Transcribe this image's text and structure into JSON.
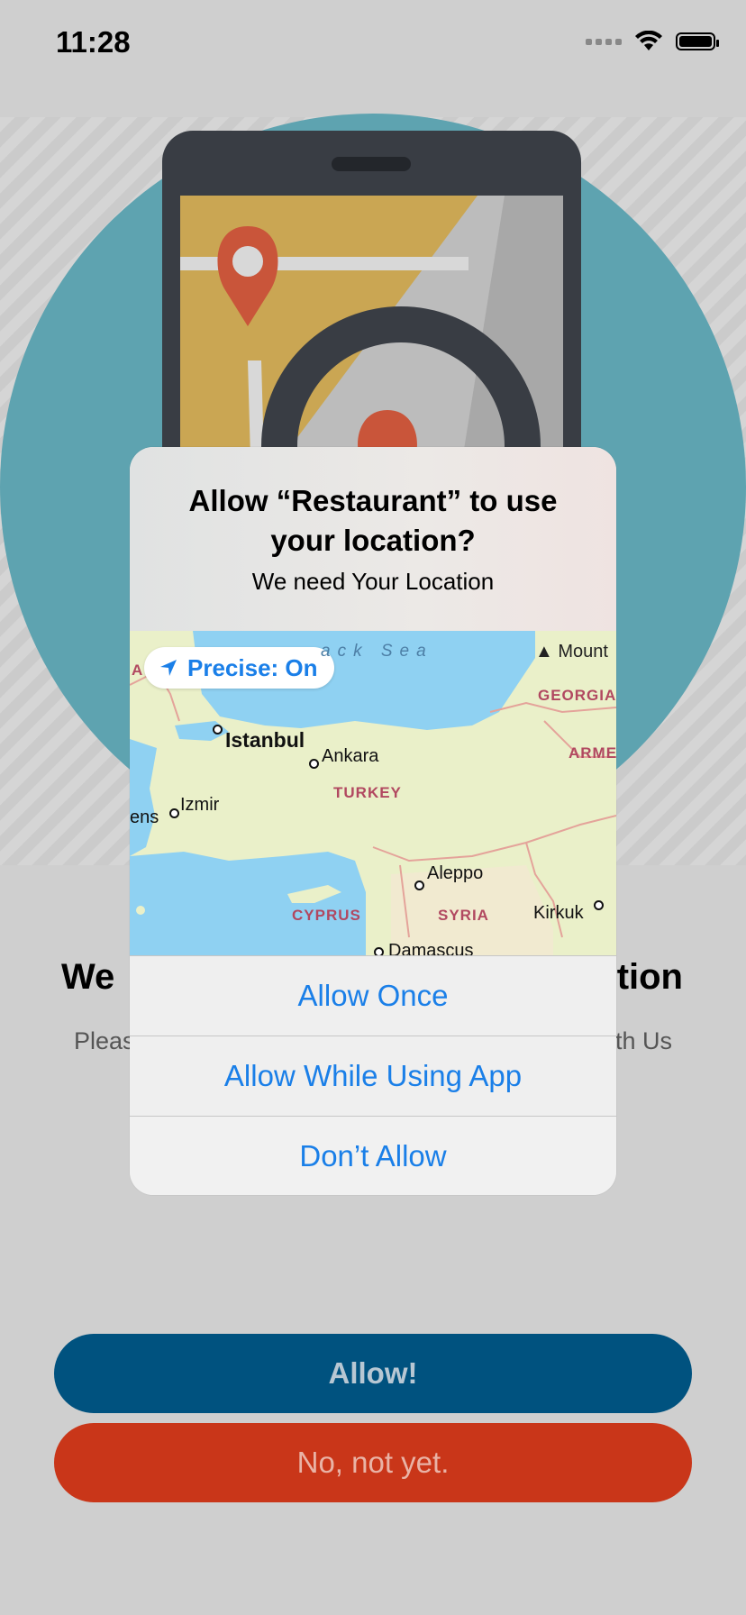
{
  "status_bar": {
    "time": "11:28"
  },
  "headline": "We need access to your location",
  "headline_visible_left": "We",
  "headline_visible_right": "tion",
  "subline_visible_left": "Pleas",
  "subline_visible_right": "th Us",
  "buttons": {
    "allow": "Allow!",
    "not_yet": "No, not yet."
  },
  "alert": {
    "title": "Allow “Restaurant” to use your location?",
    "message": "We need Your Location",
    "precise_label": "Precise: On",
    "actions": [
      "Allow Once",
      "Allow While Using App",
      "Don’t Allow"
    ]
  },
  "map": {
    "sea": "ack Sea",
    "labels": {
      "mount": "Mount",
      "georgia": "GEORGIA",
      "armenia": "ARMEI",
      "istanbul": "Istanbul",
      "ankara": "Ankara",
      "turkey": "TURKEY",
      "izmir": "Izmir",
      "athens": "ens",
      "aleppo": "Aleppo",
      "cyprus": "CYPRUS",
      "syria": "SYRIA",
      "kirkuk": "Kirkuk",
      "damascus": "Damascus",
      "edge_a": "A"
    }
  },
  "colors": {
    "background": "#cfcfcf",
    "allow_button": "#00527f",
    "not_yet_button": "#c93619",
    "accent_blue": "#1a7fe8"
  }
}
